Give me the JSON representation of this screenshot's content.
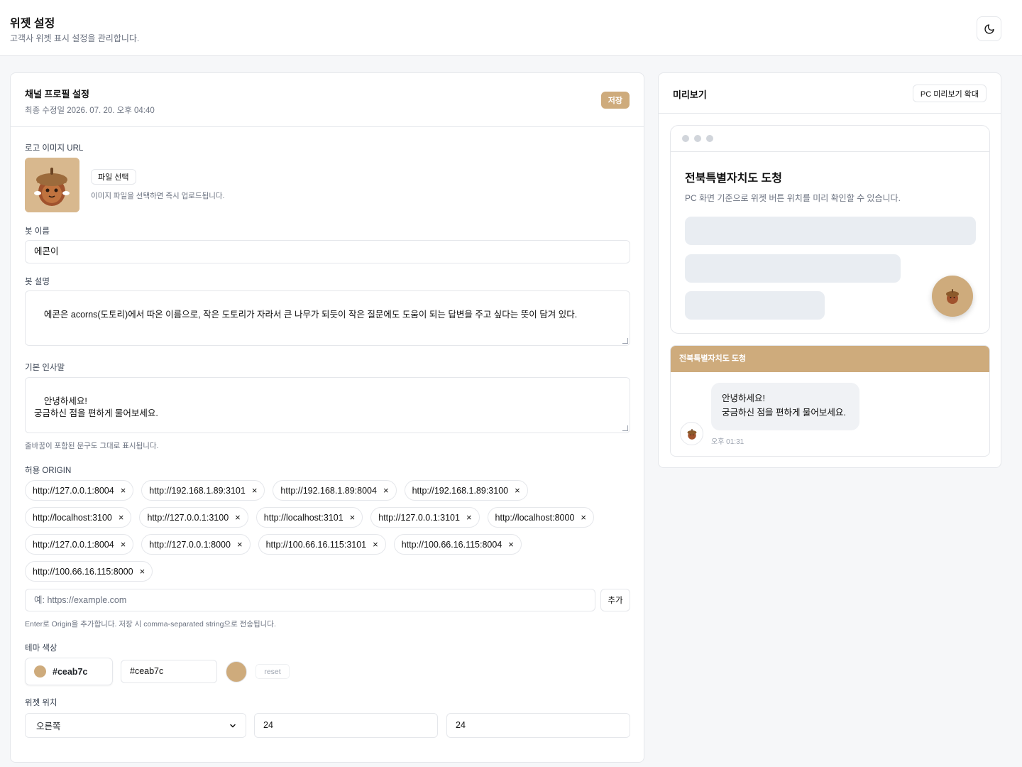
{
  "header": {
    "title": "위젯 설정",
    "subtitle": "고객사 위젯 표시 설정을 관리합니다.",
    "theme_toggle_icon": "moon-icon"
  },
  "profile": {
    "title": "채널 프로필 설정",
    "last_modified": "최종 수정일 2026. 07. 20. 오후 04:40",
    "save_label": "저장",
    "logo_label": "로고 이미지 URL",
    "file_button_label": "파일 선택",
    "file_hint": "이미지 파일을 선택하면 즉시 업로드됩니다.",
    "bot_name_label": "봇 이름",
    "bot_name_value": "에콘이",
    "bot_desc_label": "봇 설명",
    "bot_desc_value": "에콘은 acorns(도토리)에서 따온 이름으로, 작은 도토리가 자라서 큰 나무가 되듯이 작은 질문에도 도움이 되는 답변을 주고 싶다는 뜻이 담겨 있다.",
    "greeting_label": "기본 인사말",
    "greeting_value": "안녕하세요!\n궁금하신 점을 편하게 물어보세요.",
    "greeting_hint": "줄바꿈이 포함된 문구도 그대로 표시됩니다.",
    "origin_label": "허용 ORIGIN",
    "origins": [
      "http://127.0.0.1:8004",
      "http://192.168.1.89:3101",
      "http://192.168.1.89:8004",
      "http://192.168.1.89:3100",
      "http://localhost:3100",
      "http://127.0.0.1:3100",
      "http://localhost:3101",
      "http://127.0.0.1:3101",
      "http://localhost:8000",
      "http://127.0.0.1:8004",
      "http://127.0.0.1:8000",
      "http://100.66.16.115:3101",
      "http://100.66.16.115:8004",
      "http://100.66.16.115:8000"
    ],
    "origin_remove_glyph": "×",
    "origin_placeholder": "예: https://example.com",
    "origin_add_label": "추가",
    "origin_hint": "Enter로 Origin을 추가합니다. 저장 시 comma-separated string으로 전송됩니다.",
    "theme_label": "테마 색상",
    "theme_color": "#ceab7c",
    "theme_hex_value": "#ceab7c",
    "reset_label": "reset",
    "position_label": "위젯 위치",
    "position_value": "오른쪽",
    "offset_x": "24",
    "offset_y": "24"
  },
  "preview": {
    "title": "미리보기",
    "zoom_label": "PC 미리보기 확대",
    "site_title": "전북특별자치도 도청",
    "site_desc": "PC 화면 기준으로 위젯 버튼 위치를 미리 확인할 수 있습니다.",
    "chat_header": "전북특별자치도 도청",
    "chat_message": "안녕하세요!\n궁금하신 점을 편하게 물어보세요.",
    "chat_time": "오후 01:31"
  },
  "colors": {
    "accent": "#ceab7c",
    "border": "#e5e7eb",
    "skeleton": "#e9edf2"
  }
}
